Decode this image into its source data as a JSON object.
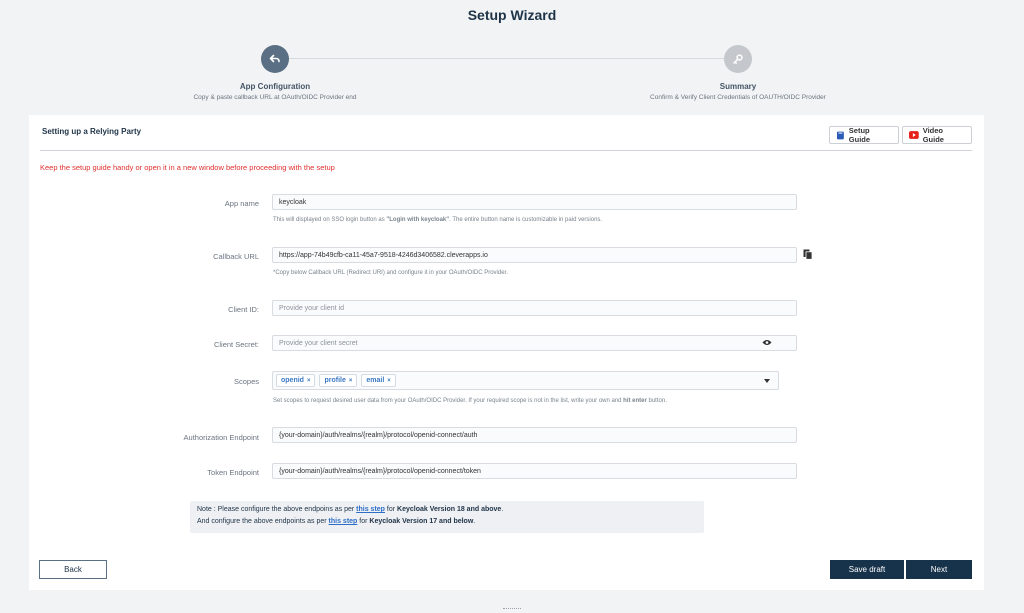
{
  "header": {
    "title": "Setup Wizard"
  },
  "steps": [
    {
      "title": "App Configuration",
      "subtitle": "Copy & paste callback URL at OAuth/OIDC Provider end",
      "icon": "undo-arrow-icon",
      "state": "active"
    },
    {
      "title": "Summary",
      "subtitle": "Confirm & Verify Client Credentials of OAUTH/OIDC Provider",
      "icon": "key-icon",
      "state": "inactive"
    }
  ],
  "card": {
    "title": "Setting up a Relying Party",
    "setup_guide_label": "Setup Guide",
    "video_guide_label": "Video Guide",
    "warning": "Keep the setup guide handy or open it in a new window before proceeding with the setup"
  },
  "form": {
    "app_name": {
      "label": "App name",
      "value": "keycloak",
      "hint_prefix": "This will displayed on SSO login button as ",
      "hint_bold": "\"Login with keycloak\"",
      "hint_suffix": ". The entire button name is customizable in paid versions."
    },
    "callback_url": {
      "label": "Callback URL",
      "value": "https://app-74b49cfb-ca11-45a7-9518-4246d3406582.cleverapps.io",
      "hint": "*Copy below Callback URL (Redirect URI) and configure it in your OAuth/OIDC Provider."
    },
    "client_id": {
      "label": "Client ID:",
      "placeholder": "Provide your client id"
    },
    "client_secret": {
      "label": "Client Secret:",
      "placeholder": "Provide your client secret"
    },
    "scopes": {
      "label": "Scopes",
      "chips": [
        "openid",
        "profile",
        "email"
      ],
      "chip_remove": "×",
      "hint_prefix": "Set scopes to request desired user data from your OAuth/OIDC Provider. If your required scope is not in the list, write your own and ",
      "hint_bold": "hit enter",
      "hint_suffix": " button."
    },
    "authorization_endpoint": {
      "label": "Authorization Endpoint",
      "value": "{your-domain}/auth/realms/{realm}/protocol/openid-connect/auth"
    },
    "token_endpoint": {
      "label": "Token Endpoint",
      "value": "{your-domain}/auth/realms/{realm}/protocol/openid-connect/token"
    }
  },
  "note": {
    "line1_prefix": "Note : Please configure the above endpoins as per ",
    "line1_link": "this step",
    "line1_mid": " for ",
    "line1_bold": "Keycloak Version 18 and above",
    "line1_end": ".",
    "line2_prefix": "And configure the above endpoints as per ",
    "line2_link": "this step",
    "line2_mid": " for ",
    "line2_bold": "Keycloak Version 17 and below",
    "line2_end": "."
  },
  "buttons": {
    "back": "Back",
    "save_draft": "Save draft",
    "next": "Next"
  },
  "colors": {
    "primary": "#17324b",
    "warning": "#e0302f",
    "link": "#2d6ec7",
    "chip_text": "#3a78c4"
  }
}
